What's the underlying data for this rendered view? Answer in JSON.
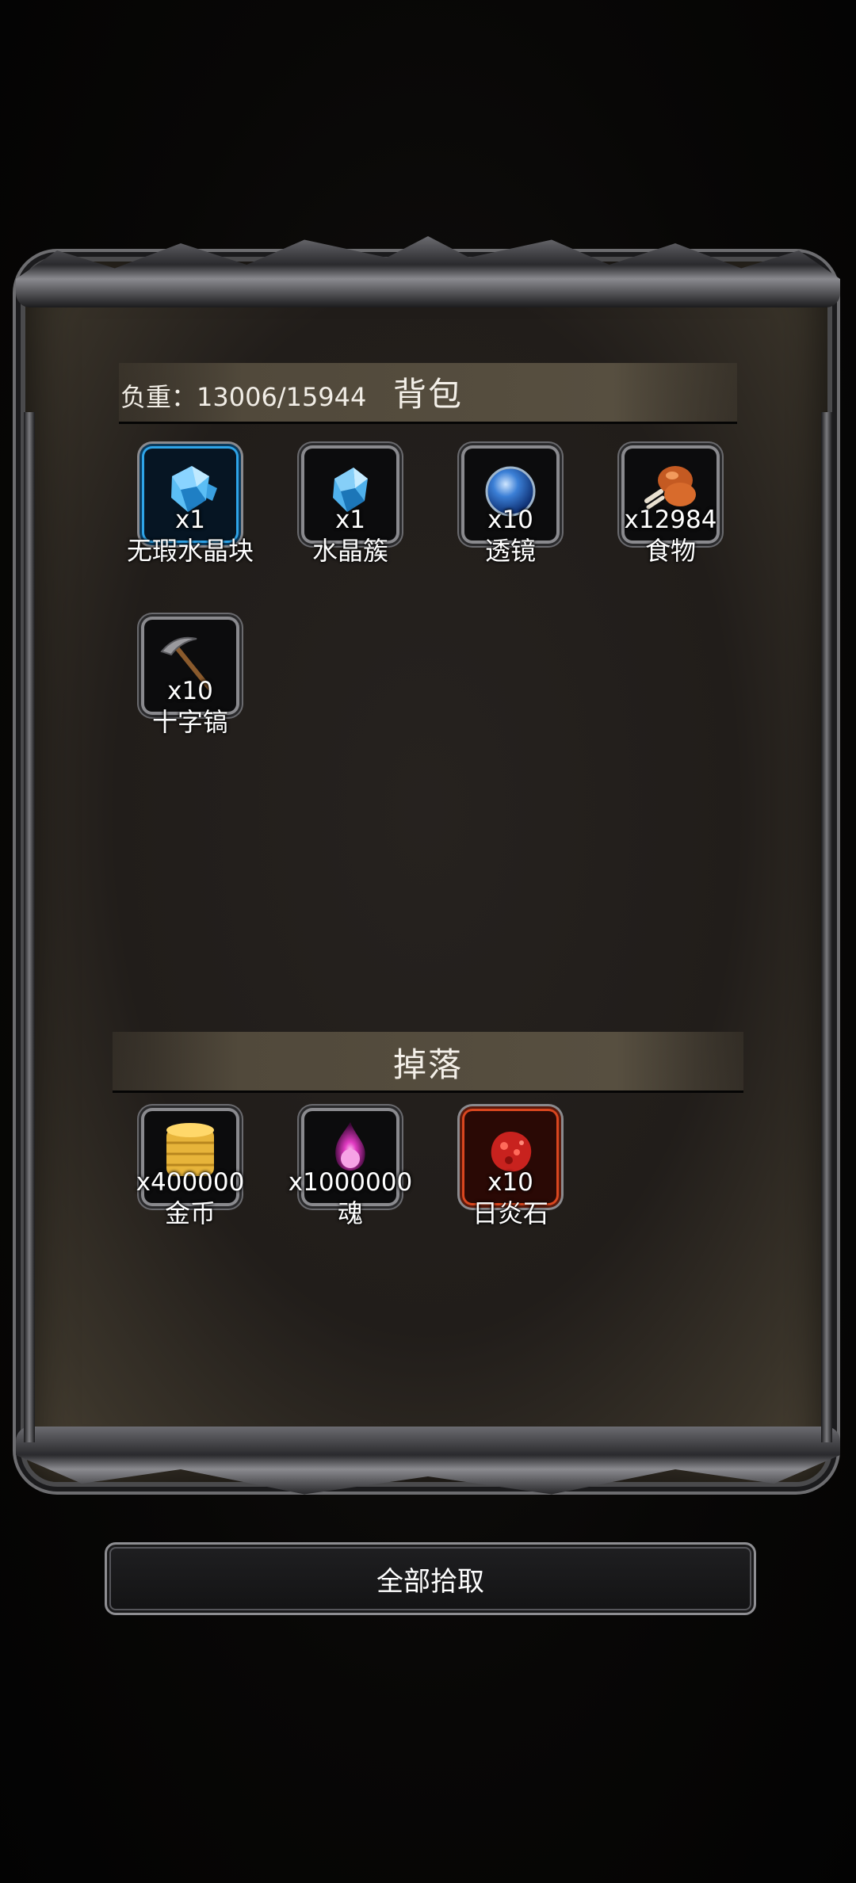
{
  "bag": {
    "weight_text": "负重：13006/15944",
    "title": "背包",
    "items": [
      {
        "name": "无瑕水晶块",
        "qty": "x1",
        "icon": "blue-crystal-icon"
      },
      {
        "name": "水晶簇",
        "qty": "x1",
        "icon": "crystal-cluster-icon"
      },
      {
        "name": "透镜",
        "qty": "x10",
        "icon": "lens-orb-icon"
      },
      {
        "name": "食物",
        "qty": "x12984",
        "icon": "meat-food-icon"
      },
      {
        "name": "十字镐",
        "qty": "x10",
        "icon": "pickaxe-icon"
      }
    ]
  },
  "drop": {
    "title": "掉落",
    "items": [
      {
        "name": "金币",
        "qty": "x400000",
        "icon": "gold-coins-icon"
      },
      {
        "name": "魂",
        "qty": "x1000000",
        "icon": "soul-flame-icon"
      },
      {
        "name": "日炎石",
        "qty": "x10",
        "icon": "sunfire-stone-icon"
      }
    ]
  },
  "actions": {
    "pickup_all": "全部拾取"
  },
  "colors": {
    "panel_bg": "#211d1a",
    "header_bar": "#51493b",
    "slot_rare_border": "#2ea4e8",
    "slot_epic_border": "#d9461f"
  }
}
